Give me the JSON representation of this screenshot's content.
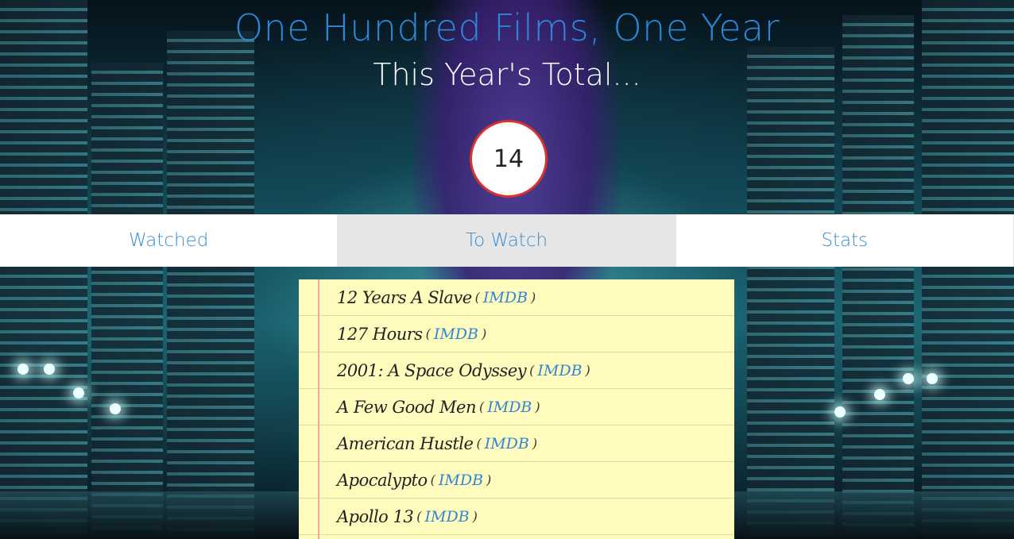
{
  "header": {
    "site_title": "One Hundred Films, One Year",
    "subtitle": "This Year's Total..."
  },
  "counter": {
    "value": "14"
  },
  "tabs": [
    {
      "label": "Watched",
      "active": false
    },
    {
      "label": "To Watch",
      "active": true
    },
    {
      "label": "Stats",
      "active": false
    }
  ],
  "films": [
    {
      "title": "12 Years A Slave",
      "link_label": "IMDB"
    },
    {
      "title": "127 Hours",
      "link_label": "IMDB"
    },
    {
      "title": "2001: A Space Odyssey",
      "link_label": "IMDB"
    },
    {
      "title": "A Few Good Men",
      "link_label": "IMDB"
    },
    {
      "title": "American Hustle",
      "link_label": "IMDB"
    },
    {
      "title": "Apocalypto",
      "link_label": "IMDB"
    },
    {
      "title": "Apollo 13",
      "link_label": "IMDB"
    }
  ],
  "punctuation": {
    "open": "(",
    "close": ")"
  },
  "colors": {
    "accent_blue": "#2e86d6",
    "counter_border": "#d9322e",
    "notepad_bg": "#fffbbd",
    "active_tab_bg": "#e6e6e6"
  }
}
